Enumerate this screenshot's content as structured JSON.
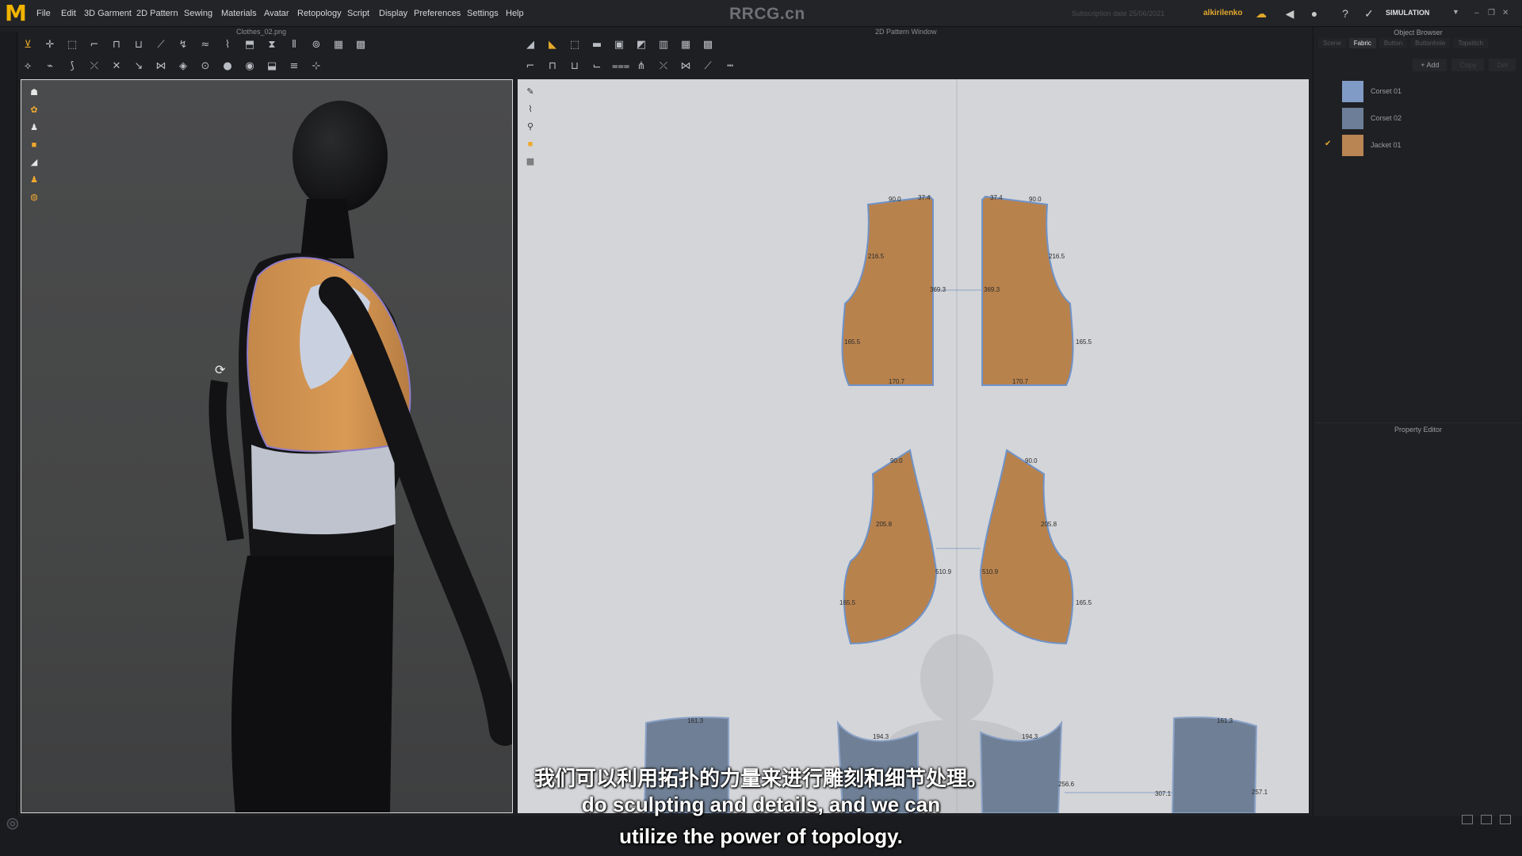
{
  "app": {
    "logo": "M",
    "watermark_title": "RRCG.cn",
    "license_text": "Subscription date 25/06/2021",
    "username": "alkirilenko",
    "mode": "SIMULATION",
    "menu": [
      "File",
      "Edit",
      "3D Garment",
      "2D Pattern",
      "Sewing",
      "Materials",
      "Avatar",
      "Retopology",
      "Script",
      "Display",
      "Preferences",
      "Settings",
      "Help"
    ]
  },
  "viewport3d": {
    "title": "Clothes_02.png"
  },
  "viewport2d": {
    "title": "2D Pattern Window",
    "measurements": {
      "upper_left": [
        "90.0",
        "37.4",
        "216.5",
        "369.3",
        "165.5",
        "170.7"
      ],
      "upper_right": [
        "37.4",
        "90.0",
        "216.5",
        "369.3",
        "165.5",
        "170.7"
      ],
      "middle_left": [
        "90.0",
        "205.8",
        "510.9",
        "165.5"
      ],
      "middle_right": [
        "90.0",
        "205.8",
        "510.9",
        "165.5"
      ],
      "bottom": [
        "161.3",
        "194.3",
        "194.3",
        "256.6",
        "307.1",
        "161.3",
        "257.1"
      ]
    }
  },
  "object_browser": {
    "title": "Object Browser",
    "tabs": [
      "Scene",
      "Fabric",
      "Button",
      "Buttonhole",
      "Topstitch"
    ],
    "active_tab": "Fabric",
    "actions": [
      "+ Add",
      "Copy",
      "Del"
    ],
    "fabrics": [
      {
        "name": "Corset 01",
        "color": "#7f9bc6",
        "checked": false
      },
      {
        "name": "Corset 02",
        "color": "#6c7e98",
        "checked": false
      },
      {
        "name": "Jacket 01",
        "color": "#b88553",
        "checked": true
      }
    ]
  },
  "property_editor": {
    "title": "Property Editor"
  },
  "subtitles": {
    "chinese": "我们可以利用拓扑的力量来进行雕刻和细节处理。",
    "english_line1": "do sculpting and details, and we can",
    "english_line2": "utilize the power of topology."
  },
  "icons": {
    "toolbar3d_row1": [
      "select-icon",
      "move-icon",
      "transform-icon",
      "fold-icon",
      "pin-icon",
      "tuck-icon",
      "brush-icon",
      "shrink-icon",
      "steam-icon",
      "puckering-icon",
      "strengthen-icon",
      "zipper-icon",
      "trim-icon",
      "button-icon",
      "grid-icon",
      "grid-2-icon"
    ],
    "toolbar3d_row2": [
      "measure-icon",
      "tape-icon",
      "sewing-icon",
      "line-sewing-icon",
      "pattern-icon",
      "segment-icon",
      "free-sewing-icon",
      "avatar-icon",
      "cloth-icon",
      "pin-2-icon",
      "weld-icon",
      "fit-icon",
      "stitch-icon",
      "split-icon"
    ],
    "toolbar2d_row1": [
      "edit-pattern-icon",
      "edit-point-icon",
      "transform-pattern-icon",
      "create-rect-icon",
      "create-poly-icon",
      "internal-shape-icon",
      "notch-icon",
      "grade-icon",
      "grid-3-icon"
    ],
    "toolbar2d_row2": [
      "seam-allowance-icon",
      "edit-seam-icon",
      "segment-sew-icon",
      "free-sew-icon",
      "check-sew-icon",
      "tack-icon",
      "pleat-icon",
      "dart-icon",
      "stitch-line-icon",
      "dashed-line-icon"
    ]
  }
}
